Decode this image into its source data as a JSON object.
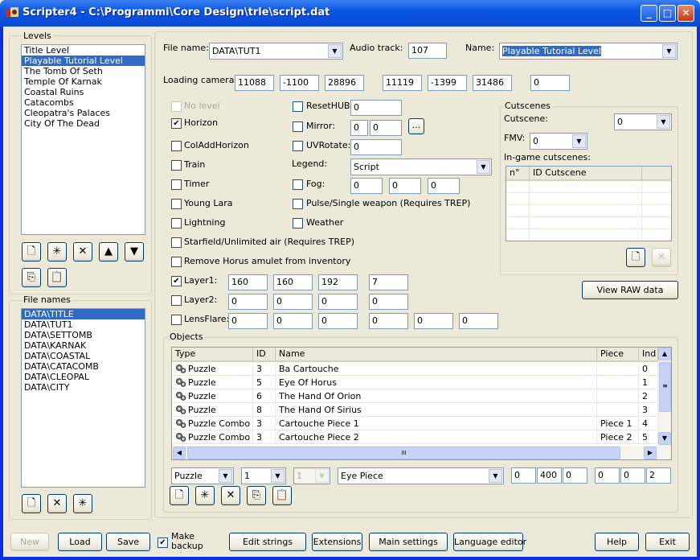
{
  "window": {
    "title": "Scripter4 - C:\\Programmi\\Core Design\\trle\\script.dat",
    "min": "_",
    "max": "□",
    "close": "✕"
  },
  "levels": {
    "label": "Levels",
    "items": [
      "Title Level",
      "Playable Tutorial Level",
      "The Tomb Of Seth",
      "Temple Of Karnak",
      "Coastal Ruins",
      "Catacombs",
      "Cleopatra's Palaces",
      "City Of The Dead"
    ],
    "selected_index": 1
  },
  "filenames": {
    "label": "File names",
    "items": [
      "DATA\\TITLE",
      "DATA\\TUT1",
      "DATA\\SETTOMB",
      "DATA\\KARNAK",
      "DATA\\COASTAL",
      "DATA\\CATACOMB",
      "DATA\\CLEOPAL",
      "DATA\\CITY"
    ],
    "selected_index": 0
  },
  "form": {
    "file_name_label": "File name:",
    "file_name": "DATA\\TUT1",
    "audio_label": "Audio track:",
    "audio": "107",
    "name_label": "Name:",
    "name": "Playable Tutorial Level",
    "loading_camera_label": "Loading camera:",
    "camera": [
      "11088",
      "-1100",
      "28896",
      "11119",
      "-1399",
      "31486",
      "0"
    ],
    "no_level": "No level",
    "horizon": "Horizon",
    "coladdhorizon": "ColAddHorizon",
    "train": "Train",
    "timer": "Timer",
    "young_lara": "Young Lara",
    "lightning": "Lightning",
    "starfield": "Starfield/Unlimited air (Requires TREP)",
    "remove_horus": "Remove Horus amulet from inventory",
    "layer1_label": "Layer1:",
    "layer1": [
      "160",
      "160",
      "192",
      "7"
    ],
    "layer2_label": "Layer2:",
    "layer2": [
      "0",
      "0",
      "0",
      "0"
    ],
    "lensflare_label": "LensFlare:",
    "lensflare": [
      "0",
      "0",
      "0",
      "0",
      "0",
      "0"
    ],
    "resethub_label": "ResetHUB:",
    "resethub": "0",
    "mirror_label": "Mirror:",
    "mirror": [
      "0",
      "0"
    ],
    "mirror_btn": "...",
    "uvrotate_label": "UVRotate:",
    "uvrotate": "0",
    "legend_label": "Legend:",
    "legend": "Script",
    "fog_label": "Fog:",
    "fog": [
      "0",
      "0",
      "0"
    ],
    "pulse": "Pulse/Single weapon (Requires TREP)",
    "weather": "Weather"
  },
  "cutscenes": {
    "group": "Cutscenes",
    "cutscene_label": "Cutscene:",
    "cutscene": "0",
    "fmv_label": "FMV:",
    "fmv": "0",
    "ingame_label": "In-game cutscenes:",
    "col_n": "n°",
    "col_id": "ID Cutscene"
  },
  "view_raw": "View RAW data",
  "objects": {
    "group": "Objects",
    "columns": [
      "Type",
      "ID",
      "Name",
      "Piece",
      "Ind"
    ],
    "rows": [
      {
        "type": "Puzzle",
        "id": "3",
        "name": "Ba Cartouche",
        "piece": "",
        "ind": "0"
      },
      {
        "type": "Puzzle",
        "id": "5",
        "name": "Eye Of Horus",
        "piece": "",
        "ind": "1"
      },
      {
        "type": "Puzzle",
        "id": "6",
        "name": "The Hand Of Orion",
        "piece": "",
        "ind": "2"
      },
      {
        "type": "Puzzle",
        "id": "8",
        "name": "The Hand Of Sirius",
        "piece": "",
        "ind": "3"
      },
      {
        "type": "Puzzle Combo",
        "id": "3",
        "name": "Cartouche Piece 1",
        "piece": "Piece 1",
        "ind": "4"
      },
      {
        "type": "Puzzle Combo",
        "id": "3",
        "name": "Cartouche Piece 2",
        "piece": "Piece 2",
        "ind": "5"
      }
    ],
    "hscroll_grip": "III",
    "editor": {
      "type": "Puzzle",
      "id": "1",
      "piece": "1",
      "name": "Eye Piece",
      "values": [
        "0",
        "400",
        "0",
        "0",
        "0",
        "2"
      ]
    }
  },
  "bottom": {
    "new": "New",
    "load": "Load",
    "save": "Save",
    "make_backup": "Make backup",
    "edit_strings": "Edit strings",
    "extensions": "Extensions",
    "main_settings": "Main settings",
    "language_editor": "Language editor",
    "help": "Help",
    "exit": "Exit"
  }
}
